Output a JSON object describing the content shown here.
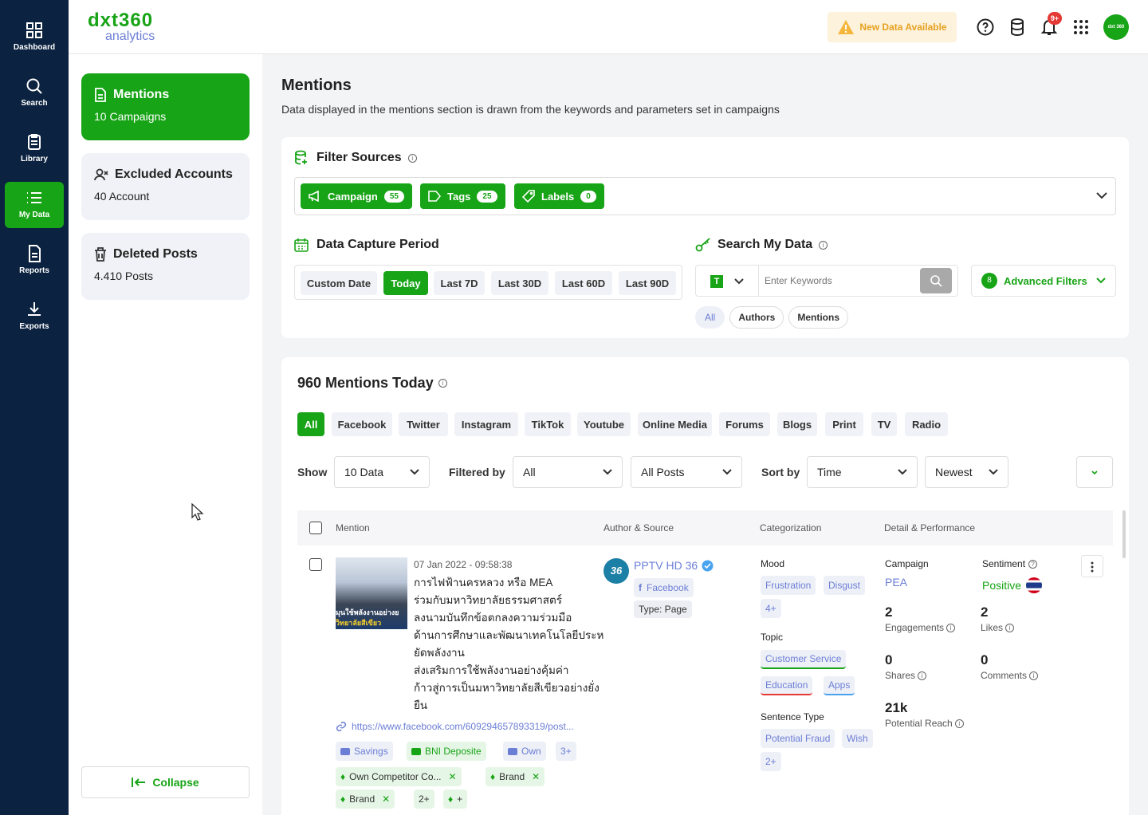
{
  "brand": {
    "logo_top": "dxt360",
    "logo_bottom": "analytics",
    "avatar_text": "dxt 360"
  },
  "rail": [
    {
      "label": "Dashboard",
      "icon": "grid-icon"
    },
    {
      "label": "Search",
      "icon": "search-icon"
    },
    {
      "label": "Library",
      "icon": "clipboard-icon"
    },
    {
      "label": "My Data",
      "icon": "list-icon"
    },
    {
      "label": "Reports",
      "icon": "document-icon"
    },
    {
      "label": "Exports",
      "icon": "download-icon"
    }
  ],
  "topbar": {
    "new_data": "New Data Available",
    "notif_badge": "9+"
  },
  "side": {
    "mentions": {
      "title": "Mentions",
      "sub": "10 Campaigns"
    },
    "excluded": {
      "title": "Excluded Accounts",
      "sub": "40 Account"
    },
    "deleted": {
      "title": "Deleted Posts",
      "sub": "4.410 Posts"
    },
    "collapse": "Collapse"
  },
  "page": {
    "title": "Mentions",
    "subtitle": "Data displayed in the mentions section is drawn from the keywords and parameters set in campaigns"
  },
  "filter_sources": {
    "title": "Filter Sources",
    "campaign": "Campaign",
    "campaign_count": "55",
    "tags": "Tags",
    "tags_count": "25",
    "labels": "Labels",
    "labels_count": "0"
  },
  "capture": {
    "title": "Data Capture Period",
    "options": [
      "Custom Date",
      "Today",
      "Last 7D",
      "Last 30D",
      "Last 60D",
      "Last 90D"
    ],
    "active": "Today"
  },
  "search": {
    "title": "Search My Data",
    "type_letter": "T",
    "placeholder": "Enter Keywords",
    "adv_count": "8",
    "adv_label": "Advanced Filters",
    "scopes": [
      "All",
      "Authors",
      "Mentions"
    ]
  },
  "results": {
    "title": "960 Mentions Today",
    "tabs": [
      "All",
      "Facebook",
      "Twitter",
      "Instagram",
      "TikTok",
      "Youtube",
      "Online Media",
      "Forums",
      "Blogs",
      "Print",
      "TV",
      "Radio"
    ],
    "show_label": "Show",
    "show_value": "10 Data",
    "filtered_label": "Filtered by",
    "filter1": "All",
    "filter2": "All Posts",
    "sort_label": "Sort by",
    "sort1": "Time",
    "sort2": "Newest",
    "columns": [
      "Mention",
      "Author & Source",
      "Categorization",
      "Detail & Performance"
    ]
  },
  "row": {
    "date": "07 Jan 2022 - 09:58:38",
    "thumb_text_1": "มุนใช้พลังงานอย่างย",
    "thumb_text_2": "วิทยาลัยสีเขียว",
    "text_lines": [
      "การไฟฟ้านครหลวง หรือ MEA",
      "ร่วมกับมหาวิทยาลัยธรรมศาสตร์",
      "ลงนามบันทึกข้อตกลงความร่วมมือ",
      "ด้านการศึกษาและพัฒนาเทคโนโลยีประห",
      "ยัดพลังงาน",
      "ส่งเสริมการใช้พลังงานอย่างคุ้มค่า",
      "ก้าวสู่การเป็นมหาวิทยาลัยสีเขียวอย่างยั่ง",
      "ยืน"
    ],
    "url": "https://www.facebook.com/609294657893319/post...",
    "labels": [
      "Savings",
      "BNI Deposite",
      "Own",
      "3+"
    ],
    "tags": [
      "Own Competitor Co...",
      "Brand",
      "Brand",
      "2+",
      "+"
    ],
    "author": "PPTV HD 36",
    "author_avatar": "36",
    "source": "Facebook",
    "type": "Type: Page",
    "mood_label": "Mood",
    "moods": [
      "Frustration",
      "Disgust",
      "4+"
    ],
    "topic_label": "Topic",
    "topics": [
      "Customer Service",
      "Education",
      "Apps"
    ],
    "sentence_label": "Sentence Type",
    "sentences": [
      "Potential Fraud",
      "Wish",
      "2+"
    ],
    "campaign_label": "Campaign",
    "campaign": "PEA",
    "sentiment_label": "Sentiment",
    "sentiment": "Positive",
    "engagements": "2",
    "engagements_label": "Engagements",
    "likes": "2",
    "likes_label": "Likes",
    "shares": "0",
    "shares_label": "Shares",
    "comments": "0",
    "comments_label": "Comments",
    "reach": "21k",
    "reach_label": "Potential Reach"
  },
  "colors": {
    "green": "#18a417",
    "navy": "#0b2240",
    "tag_blue": "#6b7ed6"
  }
}
